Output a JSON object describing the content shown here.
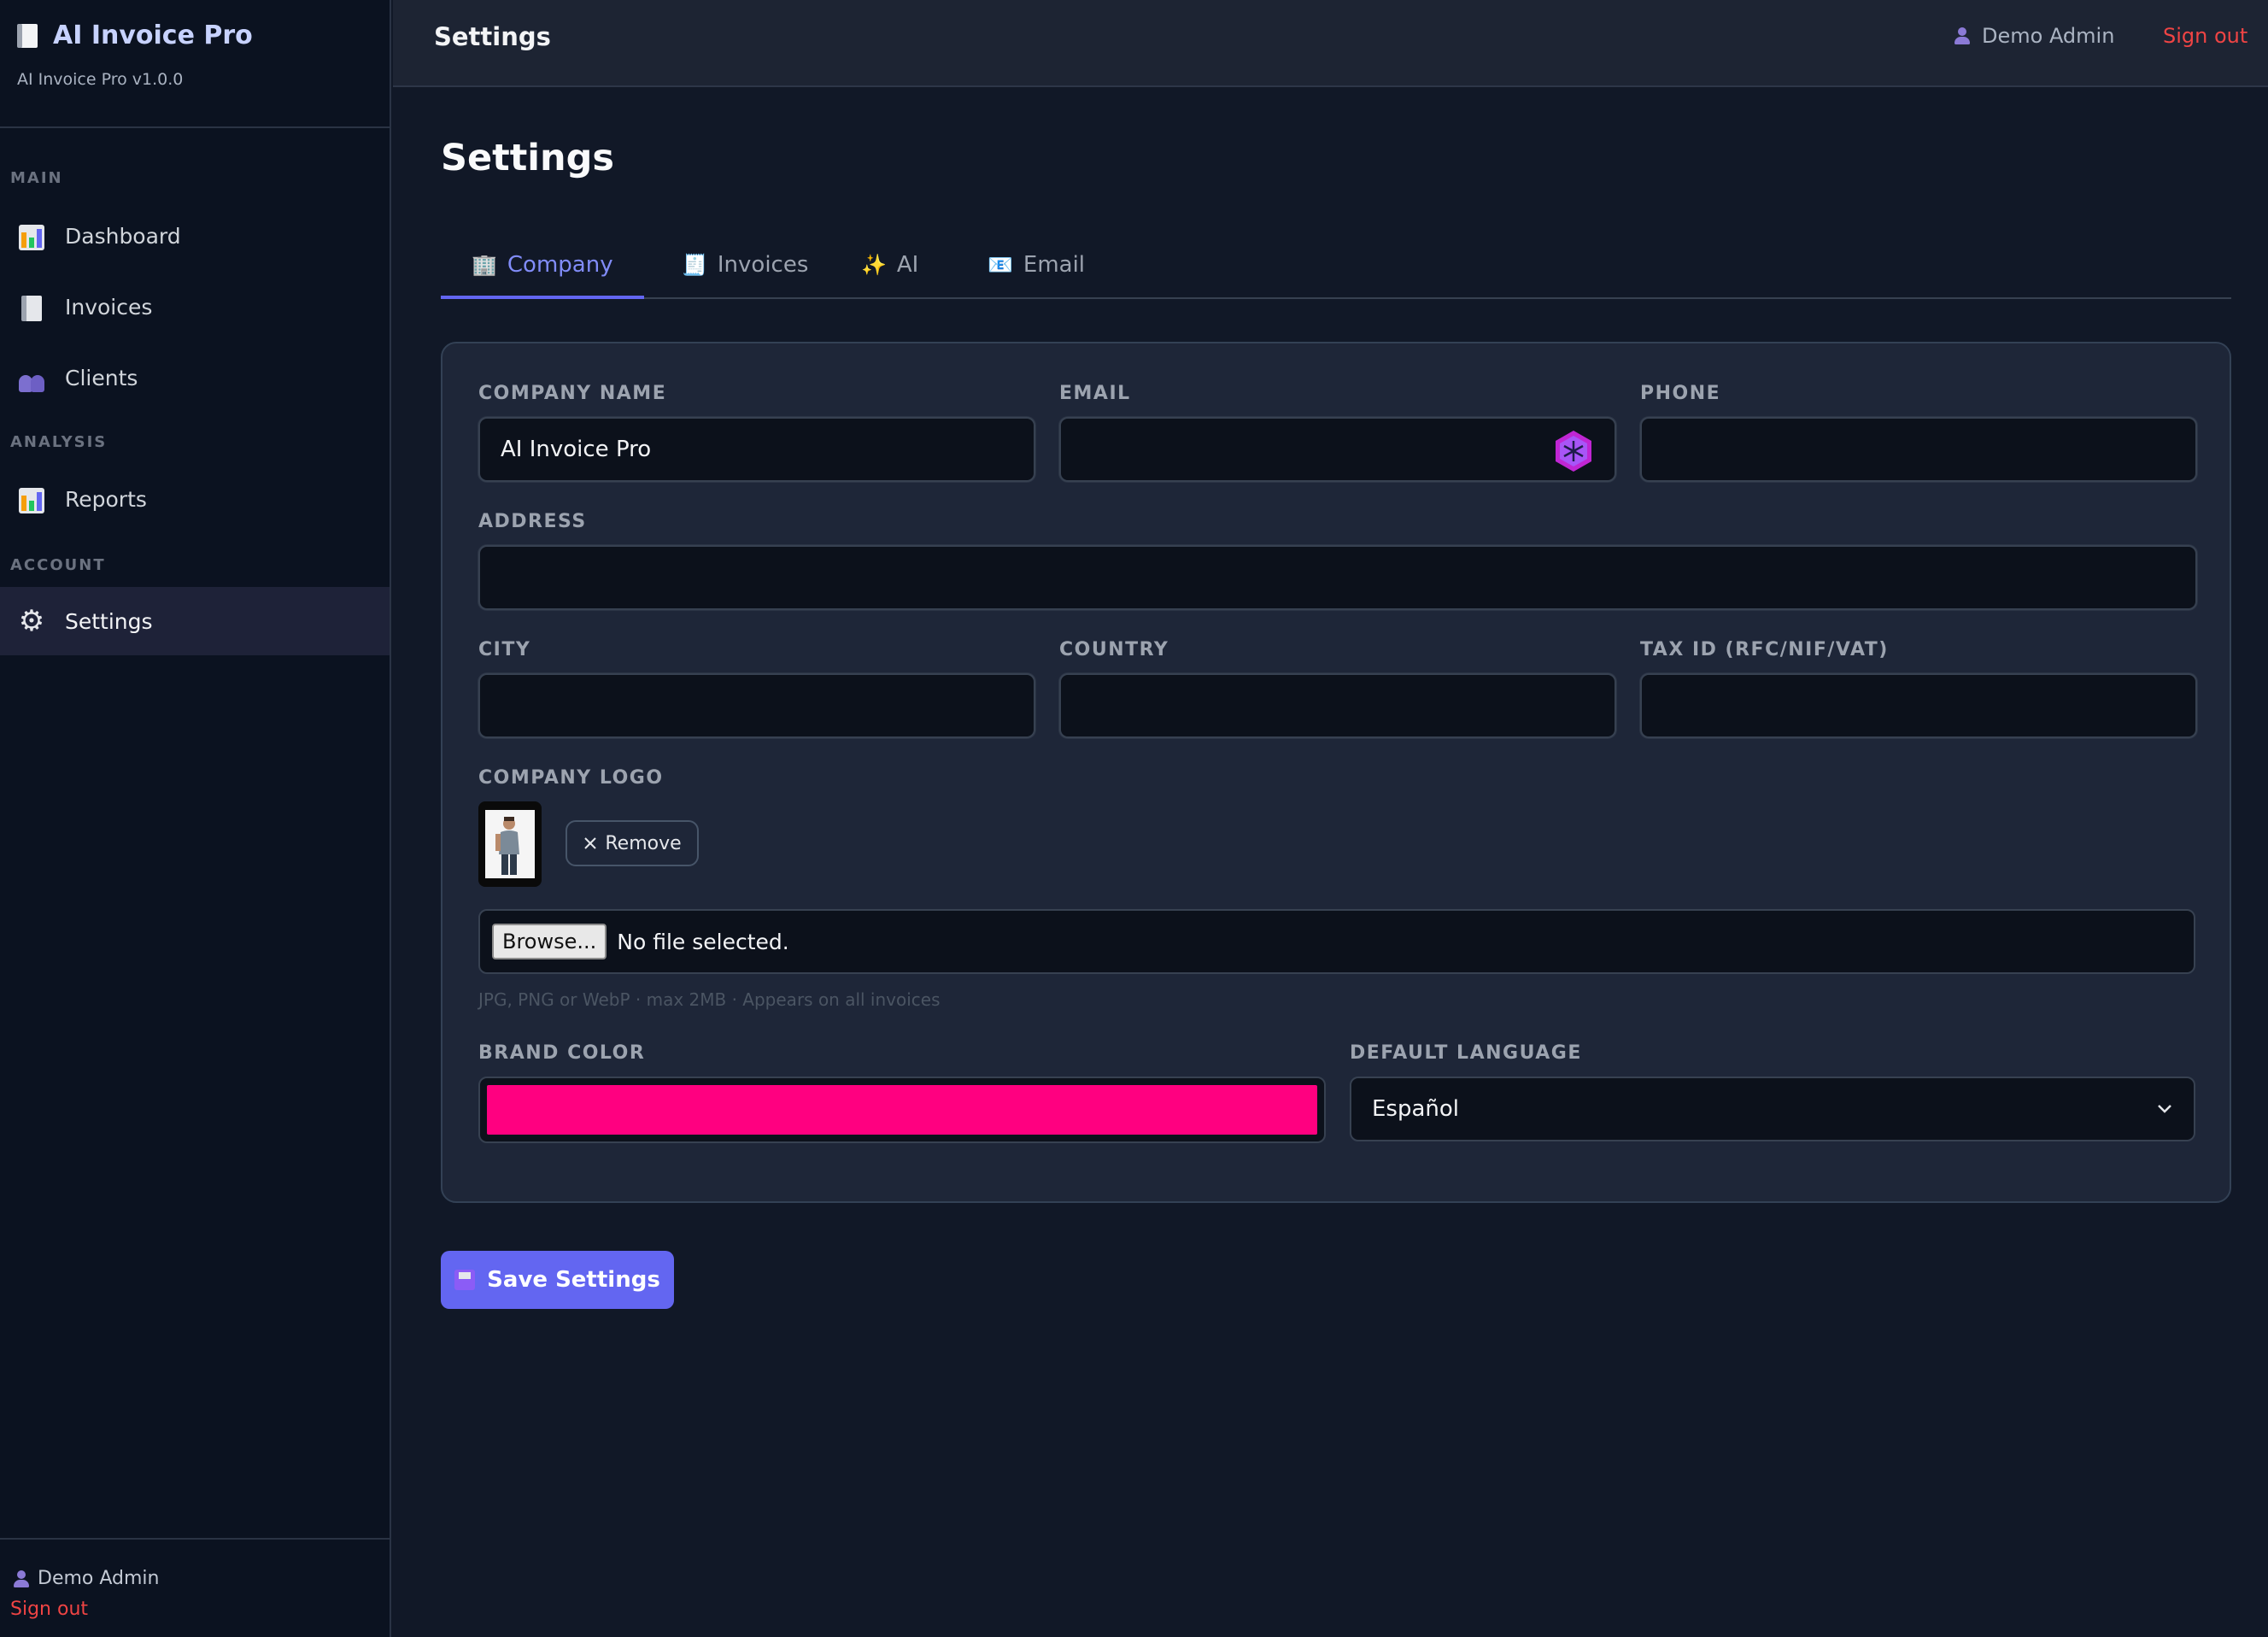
{
  "app": {
    "name": "AI Invoice Pro",
    "version": "AI Invoice Pro v1.0.0"
  },
  "sidebar": {
    "sections": [
      {
        "label": "MAIN"
      },
      {
        "label": "ANALYSIS"
      },
      {
        "label": "ACCOUNT"
      }
    ],
    "items": [
      {
        "label": "Dashboard",
        "icon": "bar-chart-icon"
      },
      {
        "label": "Invoices",
        "icon": "document-icon"
      },
      {
        "label": "Clients",
        "icon": "users-icon"
      },
      {
        "label": "Reports",
        "icon": "bar-chart-icon"
      },
      {
        "label": "Settings",
        "icon": "gear-icon",
        "active": true
      }
    ],
    "user": "Demo Admin",
    "signout": "Sign out"
  },
  "topbar": {
    "title": "Settings",
    "user": "Demo Admin",
    "separator": "·",
    "signout": "Sign out"
  },
  "page": {
    "title": "Settings",
    "tabs": [
      {
        "label": "Company",
        "icon": "building-icon",
        "active": true
      },
      {
        "label": "Invoices",
        "icon": "document-icon"
      },
      {
        "label": "AI",
        "icon": "sparkles-icon"
      },
      {
        "label": "Email",
        "icon": "envelope-icon"
      }
    ]
  },
  "form": {
    "company_name": {
      "label": "COMPANY NAME",
      "value": "AI Invoice Pro"
    },
    "email": {
      "label": "EMAIL",
      "value": ""
    },
    "phone": {
      "label": "PHONE",
      "value": ""
    },
    "address": {
      "label": "ADDRESS",
      "value": ""
    },
    "city": {
      "label": "CITY",
      "value": ""
    },
    "country": {
      "label": "COUNTRY",
      "value": ""
    },
    "tax_id": {
      "label": "TAX ID (RFC/NIF/VAT)",
      "value": ""
    },
    "logo": {
      "label": "COMPANY LOGO",
      "remove_label": "Remove",
      "browse_label": "Browse...",
      "file_status": "No file selected.",
      "hint": "JPG, PNG or WebP · max 2MB · Appears on all invoices"
    },
    "brand_color": {
      "label": "BRAND COLOR",
      "value": "#ff0080"
    },
    "language": {
      "label": "DEFAULT LANGUAGE",
      "value": "Español"
    }
  },
  "actions": {
    "save_label": "Save Settings"
  },
  "colors": {
    "accent": "#6366f1",
    "danger": "#ef4444",
    "background": "#111827",
    "sidebar": "#0b1220",
    "card": "#1e2638"
  }
}
